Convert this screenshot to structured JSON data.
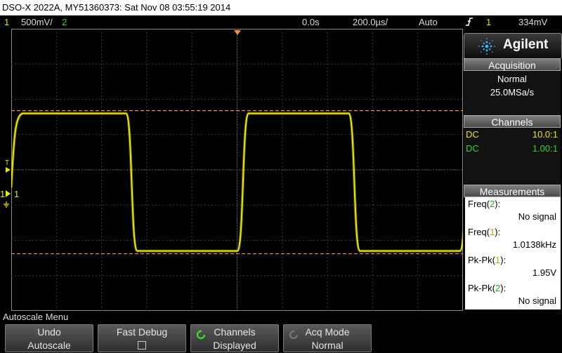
{
  "title": "DSO-X 2022A, MY51360373: Sat Nov 08 03:55:19 2014",
  "status": {
    "ch1_num": "1",
    "ch1_scale": "500mV/",
    "ch2_num": "2",
    "time_offset": "0.0s",
    "timebase": "200.0µs/",
    "trigger_mode": "Auto",
    "trigger_slope_icon": "rising-edge-icon",
    "trigger_channel": "1",
    "trigger_level": "334mV"
  },
  "markers": {
    "trigger_t": "T",
    "ch1_ground": "1"
  },
  "colors": {
    "ch1": "#e8e800",
    "ch2": "#2fd62f",
    "cursor": "#ff8c2a",
    "grid": "#3c3c3c",
    "key_grad_top": "#5a5a5a"
  },
  "panel": {
    "brand": "Agilent",
    "acquisition": {
      "title": "Acquisition",
      "mode": "Normal",
      "rate": "25.0MSa/s"
    },
    "channels": {
      "title": "Channels",
      "ch1": {
        "coupling": "DC",
        "probe": "10.0:1"
      },
      "ch2": {
        "coupling": "DC",
        "probe": "1.00:1"
      }
    },
    "measurements": {
      "title": "Measurements",
      "items": [
        {
          "label_pre": "Freq(",
          "ch": "2",
          "label_post": "):",
          "value": "No signal",
          "ch_color": "ch2"
        },
        {
          "label_pre": "Freq(",
          "ch": "1",
          "label_post": "):",
          "value": "1.0138kHz",
          "ch_color": "ch1"
        },
        {
          "label_pre": "Pk-Pk(",
          "ch": "1",
          "label_post": "):",
          "value": "1.95V",
          "ch_color": "ch1"
        },
        {
          "label_pre": "Pk-Pk(",
          "ch": "2",
          "label_post": "):",
          "value": "No signal",
          "ch_color": "ch2"
        }
      ]
    }
  },
  "menu": {
    "title": "Autoscale Menu",
    "keys": [
      {
        "line1": "Undo",
        "line2": "Autoscale"
      },
      {
        "line1": "Fast Debug",
        "line2": ""
      },
      {
        "line1": "Channels",
        "line2": "Displayed"
      },
      {
        "line1": "Acq Mode",
        "line2": "Normal"
      }
    ]
  },
  "waveform": {
    "grid": {
      "hdiv": 10,
      "vdiv": 8
    },
    "signal": {
      "type": "square",
      "channel": 1,
      "frequency_khz": 1.0138,
      "pk_pk_volts": 1.95,
      "high_divisions_from_center": 1.6,
      "low_divisions_from_center": -2.3,
      "first_falling_edge_divisions": 2.65,
      "period_divisions": 4.93
    }
  }
}
